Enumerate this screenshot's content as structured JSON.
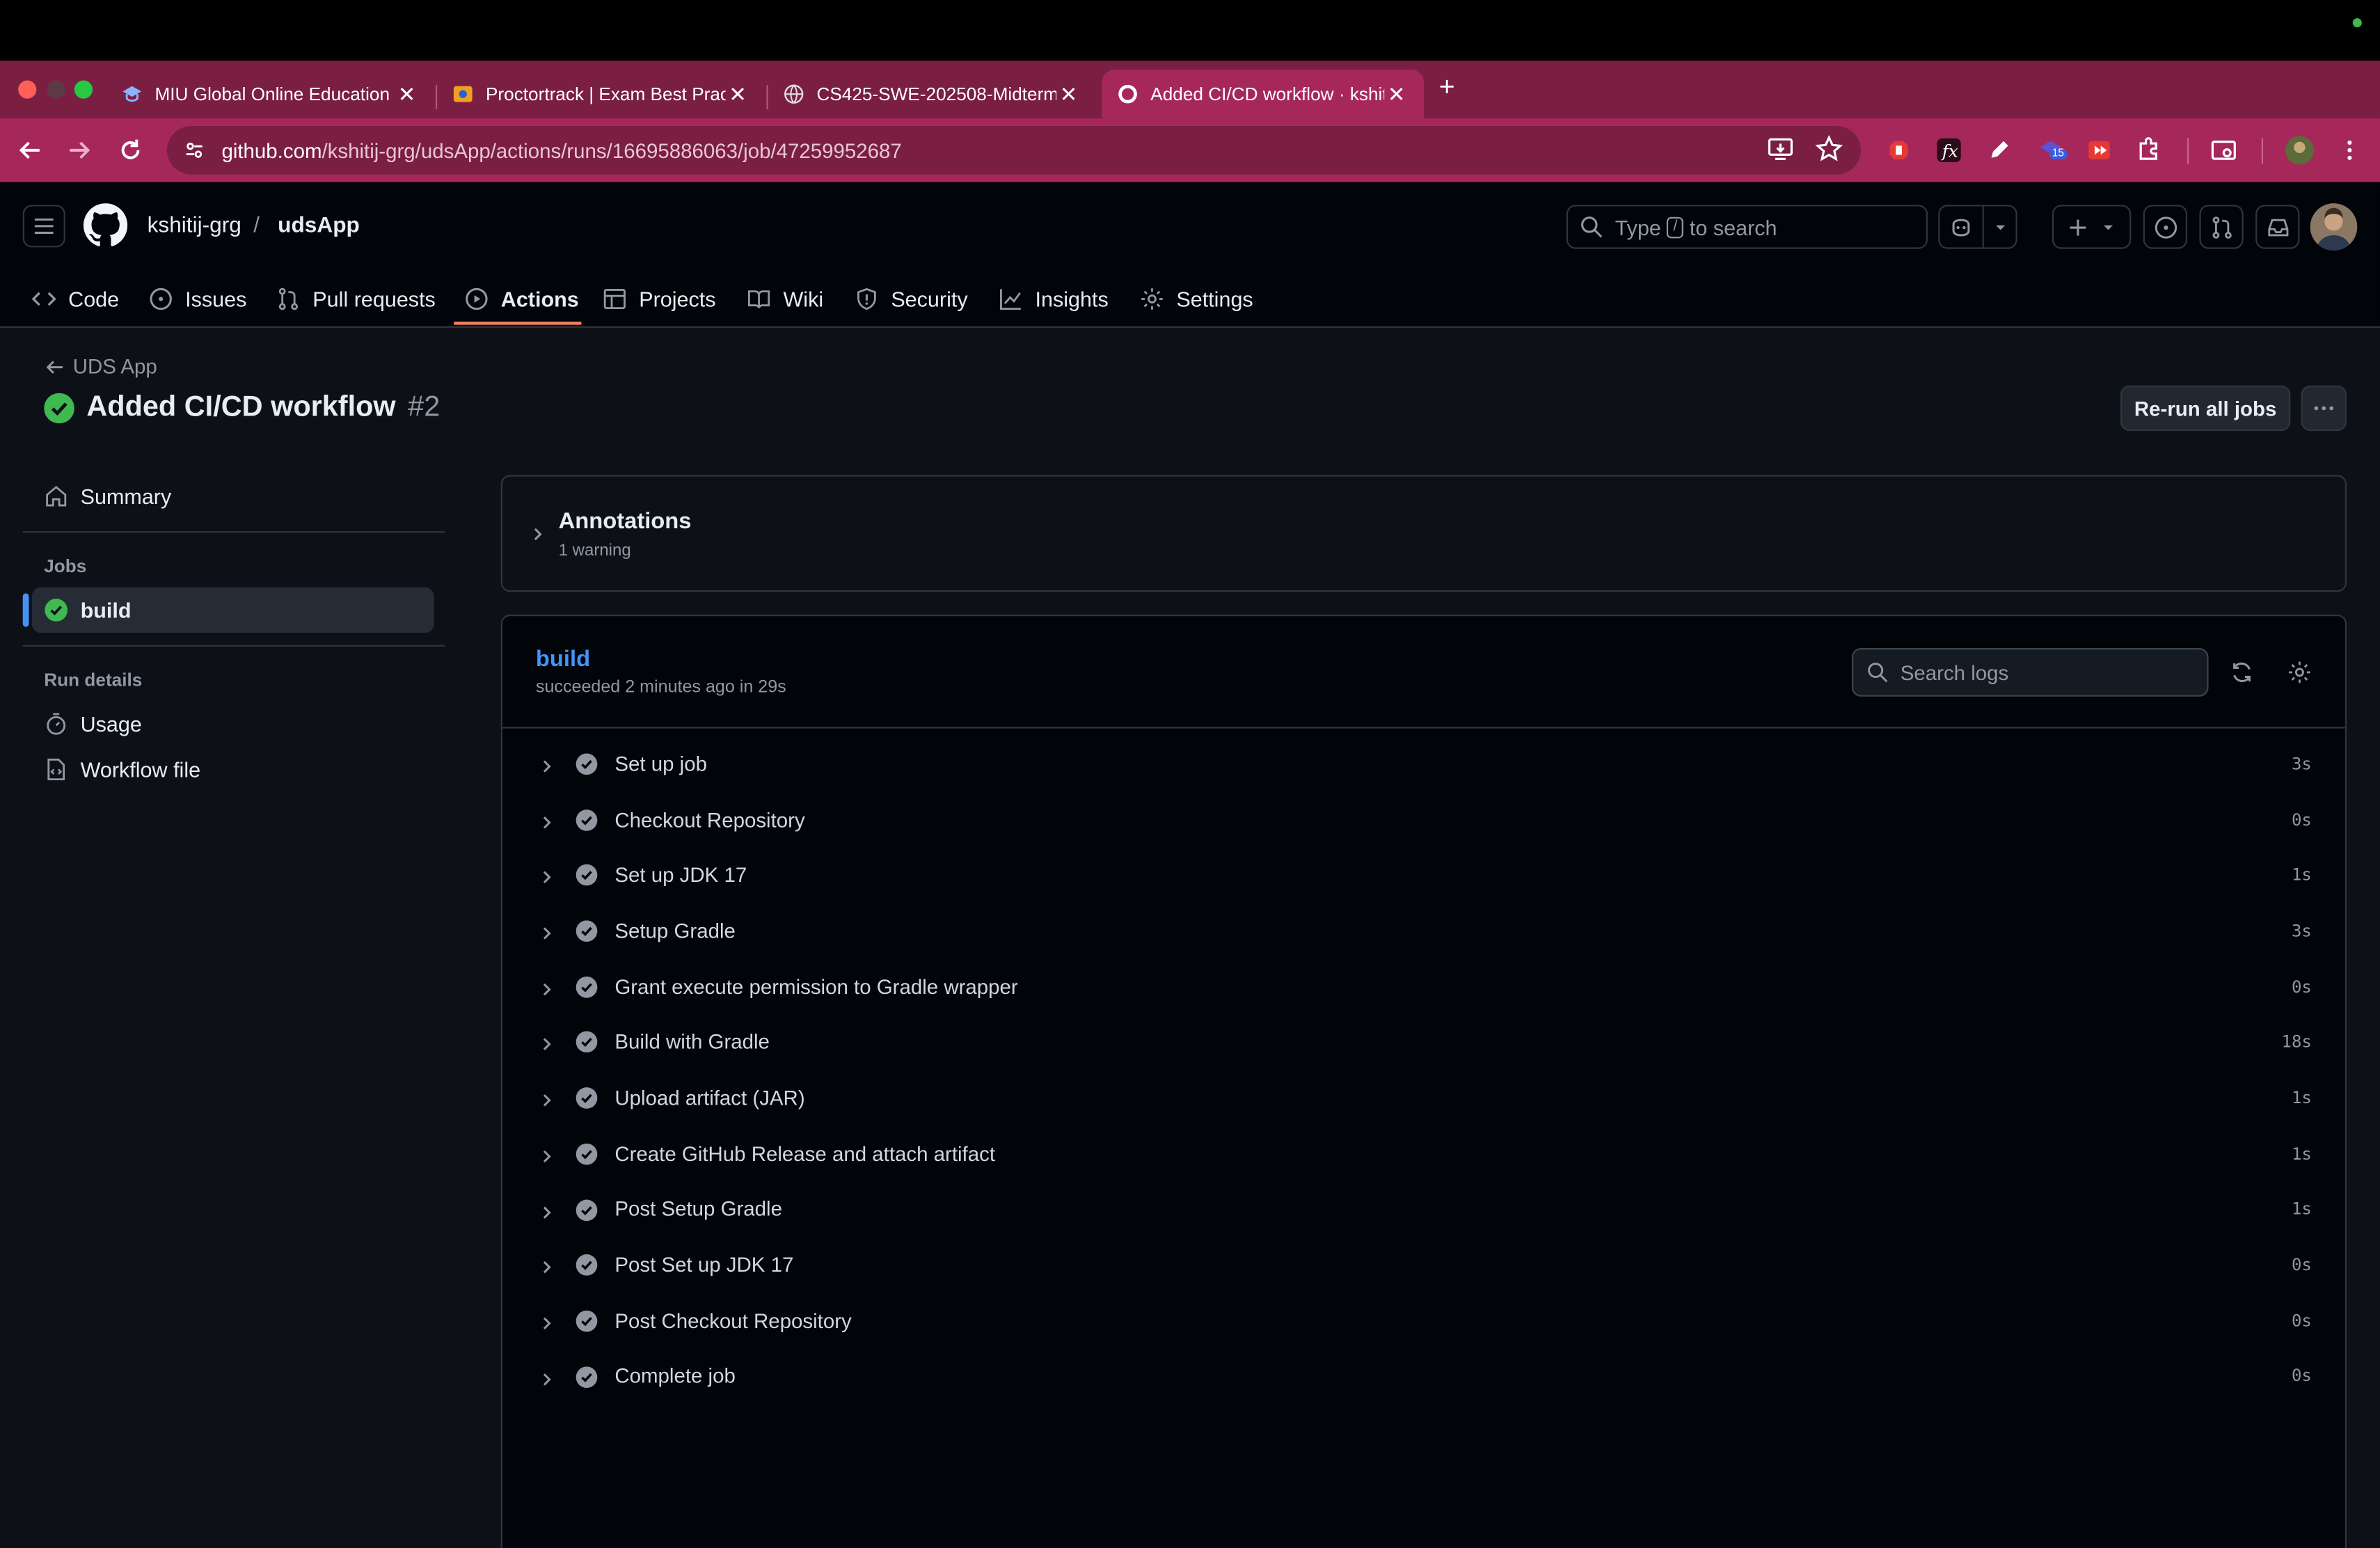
{
  "browser": {
    "tabs": [
      {
        "title": "MIU Global Online Education",
        "active": false
      },
      {
        "title": "Proctortrack | Exam Best Prac",
        "active": false
      },
      {
        "title": "CS425-SWE-202508-Midterm",
        "active": false
      },
      {
        "title": "Added CI/CD workflow · kshit",
        "active": true
      }
    ],
    "url_host": "github.com",
    "url_path": "/kshitij-grg/udsApp/actions/runs/16695886063/job/47259952687",
    "extension_badge": "15"
  },
  "header": {
    "owner": "kshitij-grg",
    "separator": "/",
    "repo": "udsApp",
    "search_prefix": "Type",
    "search_key": "/",
    "search_suffix": "to search"
  },
  "repo_nav": [
    {
      "label": "Code",
      "icon": "code-icon"
    },
    {
      "label": "Issues",
      "icon": "issue-icon"
    },
    {
      "label": "Pull requests",
      "icon": "pull-request-icon"
    },
    {
      "label": "Actions",
      "icon": "play-icon",
      "active": true
    },
    {
      "label": "Projects",
      "icon": "table-icon"
    },
    {
      "label": "Wiki",
      "icon": "book-icon"
    },
    {
      "label": "Security",
      "icon": "shield-icon"
    },
    {
      "label": "Insights",
      "icon": "graph-icon"
    },
    {
      "label": "Settings",
      "icon": "gear-icon"
    }
  ],
  "run": {
    "back_label": "UDS App",
    "title": "Added CI/CD workflow",
    "number": "#2",
    "rerun_label": "Re-run all jobs"
  },
  "sidebar": {
    "summary": "Summary",
    "jobs_heading": "Jobs",
    "job": "build",
    "run_details_heading": "Run details",
    "usage": "Usage",
    "workflow_file": "Workflow file"
  },
  "annotations": {
    "title": "Annotations",
    "subtitle": "1 warning"
  },
  "job": {
    "name": "build",
    "status": "succeeded 2 minutes ago in 29s",
    "search_placeholder": "Search logs",
    "steps": [
      {
        "name": "Set up job",
        "time": "3s"
      },
      {
        "name": "Checkout Repository",
        "time": "0s"
      },
      {
        "name": "Set up JDK 17",
        "time": "1s"
      },
      {
        "name": "Setup Gradle",
        "time": "3s"
      },
      {
        "name": "Grant execute permission to Gradle wrapper",
        "time": "0s"
      },
      {
        "name": "Build with Gradle",
        "time": "18s"
      },
      {
        "name": "Upload artifact (JAR)",
        "time": "1s"
      },
      {
        "name": "Create GitHub Release and attach artifact",
        "time": "1s"
      },
      {
        "name": "Post Setup Gradle",
        "time": "1s"
      },
      {
        "name": "Post Set up JDK 17",
        "time": "0s"
      },
      {
        "name": "Post Checkout Repository",
        "time": "0s"
      },
      {
        "name": "Complete job",
        "time": "0s"
      }
    ]
  },
  "colors": {
    "accent_blue": "#4493f8",
    "success_green": "#3fb950",
    "tab_active": "#a6285b",
    "nav_underline": "#f78166"
  }
}
